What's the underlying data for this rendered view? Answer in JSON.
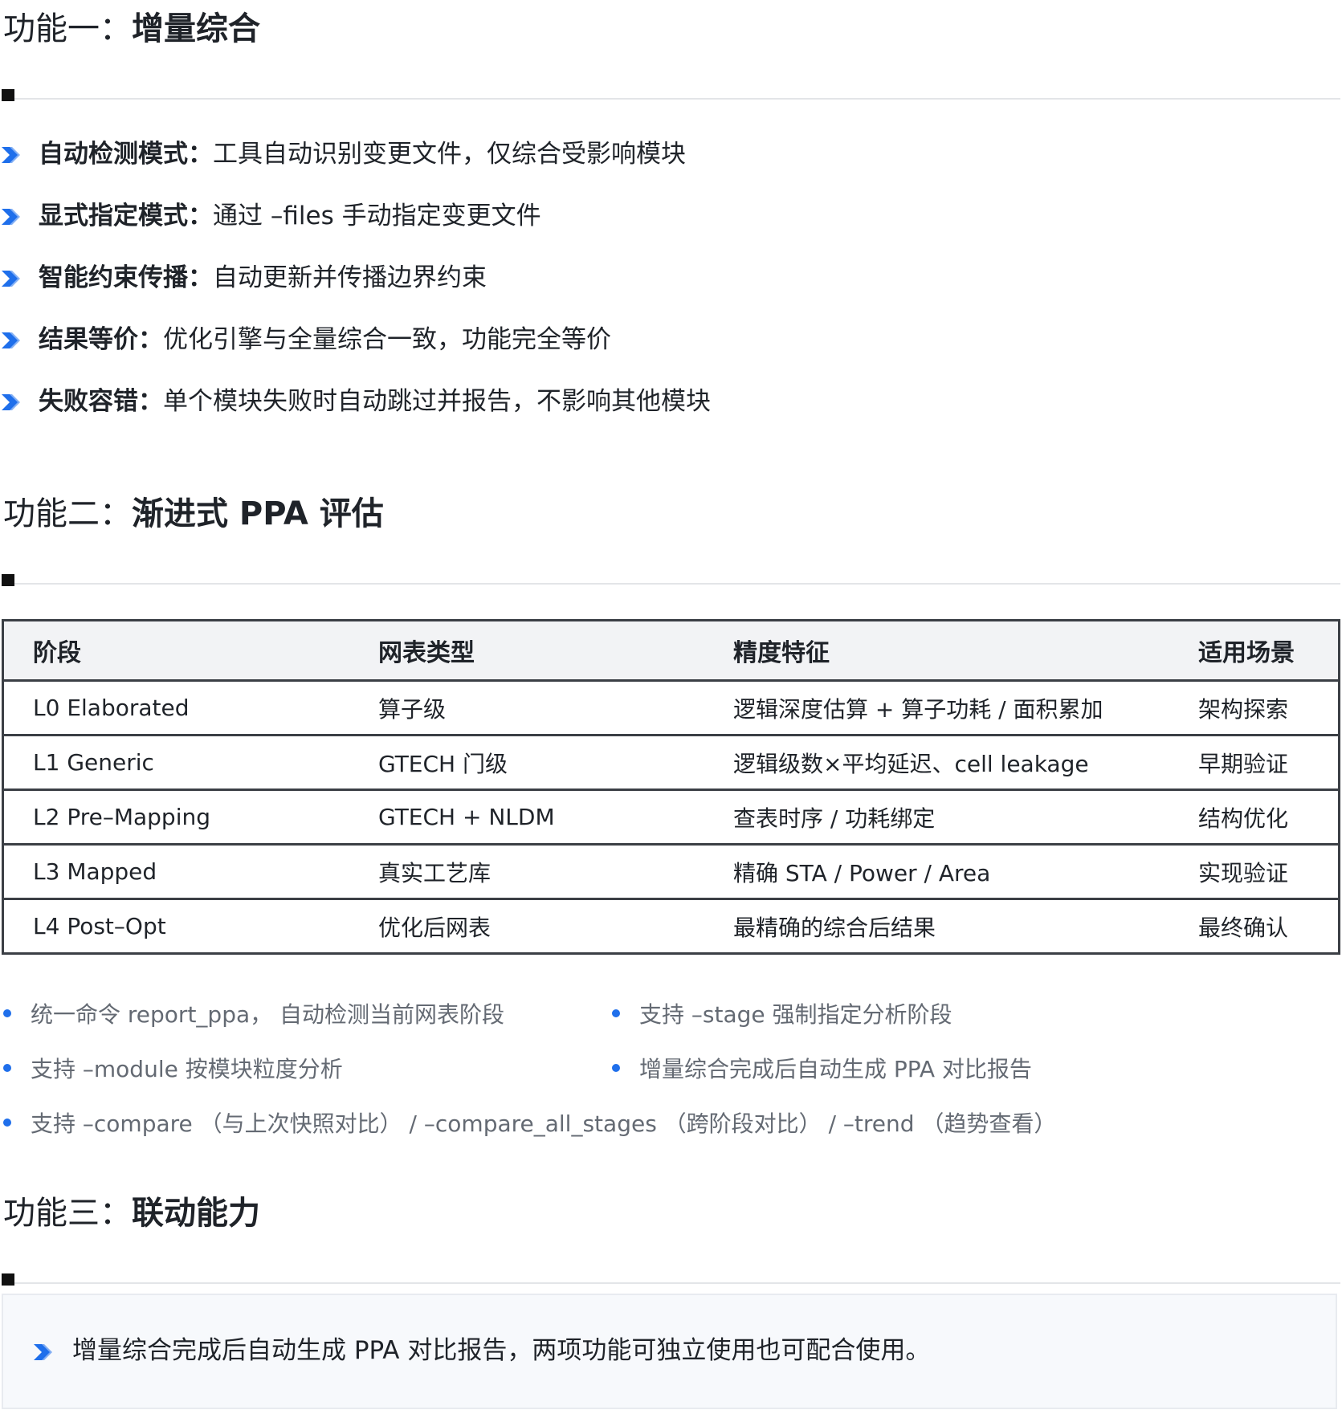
{
  "sections": [
    {
      "prefix": "功能一：",
      "title": "增量综合"
    },
    {
      "prefix": "功能二：",
      "title": "渐进式 PPA 评估"
    },
    {
      "prefix": "功能三：",
      "title": "联动能力"
    }
  ],
  "features": [
    {
      "term": "自动检测模式：",
      "desc": "工具自动识别变更文件，仅综合受影响模块"
    },
    {
      "term": "显式指定模式：",
      "desc": "通过 –files  手动指定变更文件"
    },
    {
      "term": "智能约束传播：",
      "desc": "自动更新并传播边界约束"
    },
    {
      "term": "结果等价：",
      "desc": "优化引擎与全量综合一致，功能完全等价"
    },
    {
      "term": "失败容错：",
      "desc": "单个模块失败时自动跳过并报告，不影响其他模块"
    }
  ],
  "table": {
    "headers": [
      "阶段",
      "网表类型",
      "精度特征",
      "适用场景"
    ],
    "rows": [
      [
        "L0 Elaborated",
        "算子级",
        "逻辑深度估算 +  算子功耗 / 面积累加",
        "架构探索"
      ],
      [
        "L1 Generic",
        "GTECH 门级",
        "逻辑级数×平均延迟、cell leakage",
        "早期验证"
      ],
      [
        "L2 Pre–Mapping",
        "GTECH + NLDM",
        "查表时序 / 功耗绑定",
        "结构优化"
      ],
      [
        "L3 Mapped",
        "真实工艺库",
        "精确 STA / Power / Area",
        "实现验证"
      ],
      [
        "L4 Post–Opt",
        "优化后网表",
        "最精确的综合后结果",
        "最终确认"
      ]
    ]
  },
  "notes": [
    "统一命令 report_ppa， 自动检测当前网表阶段",
    "支持 –stage  强制指定分析阶段",
    "支持 –module  按模块粒度分析",
    "增量综合完成后自动生成 PPA  对比报告",
    "支持 –compare （与上次快照对比） / –compare_all_stages （跨阶段对比） / –trend （趋势查看）"
  ],
  "callout": "增量综合完成后自动生成 PPA 对比报告，两项功能可独立使用也可配合使用。",
  "colors": {
    "accent": "#1f6feb",
    "text": "#1f2329",
    "muted": "#646a73",
    "table_border": "#3b3f45",
    "header_bg": "#f2f3f5"
  },
  "icons": {
    "bullet": "chevron-right-icon",
    "divider_mark": "square-marker"
  }
}
